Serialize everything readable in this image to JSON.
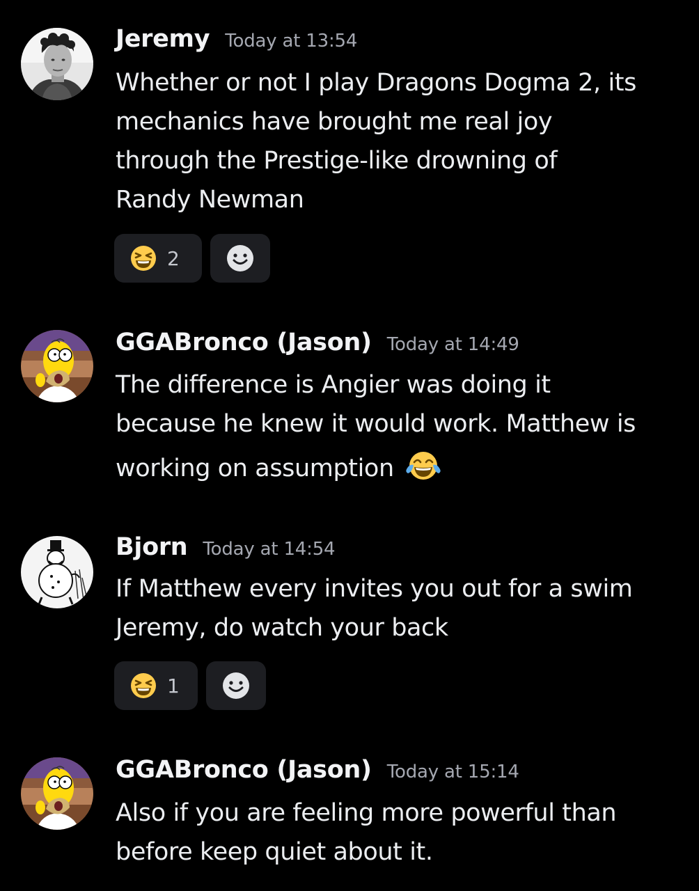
{
  "messages": [
    {
      "username": "Jeremy",
      "timestamp": "Today at 13:54",
      "lines": [
        "Whether or not I play Dragons Dogma 2, its",
        "mechanics have brought me real joy",
        "through the Prestige-like drowning of",
        "Randy Newman"
      ],
      "reactions": [
        {
          "emoji": "laughing-squint-emoji",
          "count": "2"
        }
      ]
    },
    {
      "username": "GGABronco (Jason)",
      "timestamp": "Today at 14:49",
      "lines": [
        "The difference is Angier was doing it",
        "because he knew it would work. Matthew is",
        "working on assumption"
      ],
      "inline_emoji": "tears-of-joy-emoji"
    },
    {
      "username": "Bjorn",
      "timestamp": "Today at 14:54",
      "lines": [
        "If Matthew every invites you out for a swim",
        "Jeremy, do watch your back"
      ],
      "reactions": [
        {
          "emoji": "laughing-squint-emoji",
          "count": "1"
        }
      ]
    },
    {
      "username": "GGABronco (Jason)",
      "timestamp": "Today at 15:14",
      "lines": [
        "Also if you are feeling more powerful than",
        "before keep quiet about it."
      ]
    }
  ],
  "colors": {
    "background": "#000000",
    "username": "#f2f3f5",
    "timestamp": "#a5a8b1",
    "reaction_bg": "#1d1e22",
    "emoji_yellow": "#ffcc4d"
  }
}
